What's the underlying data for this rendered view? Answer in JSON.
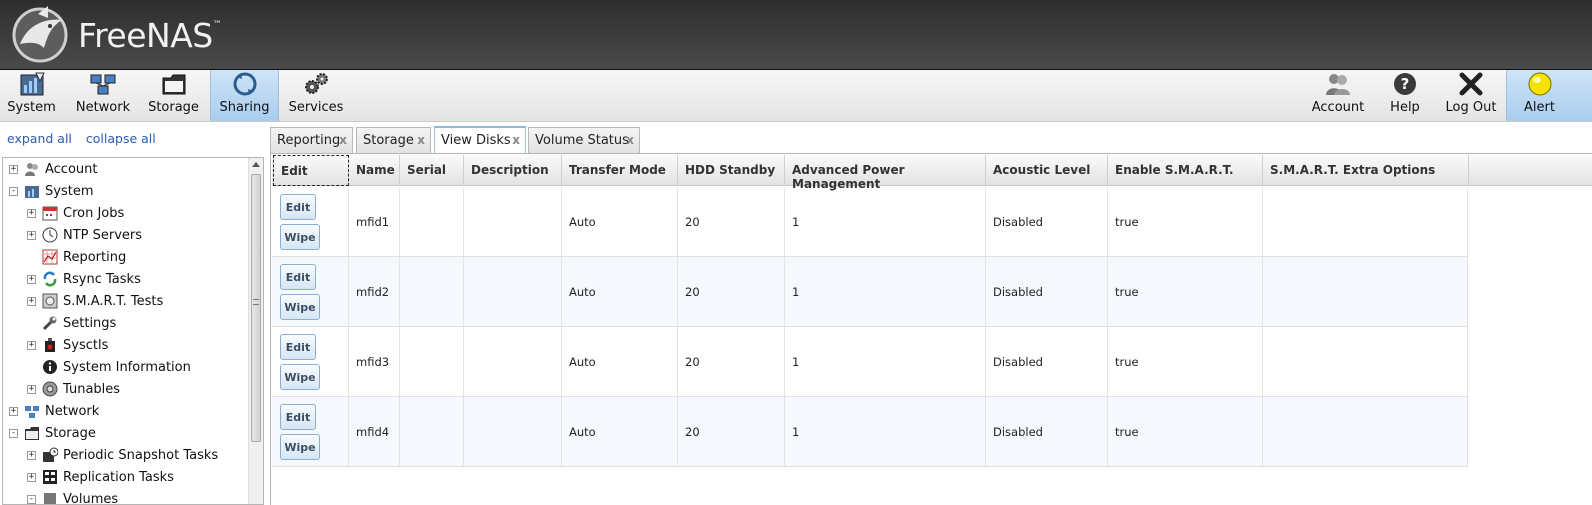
{
  "app": {
    "name": "FreeNAS",
    "trademark": "™"
  },
  "toolbar": {
    "left": [
      {
        "label": "System",
        "icon": "system-icon"
      },
      {
        "label": "Network",
        "icon": "network-icon"
      },
      {
        "label": "Storage",
        "icon": "storage-icon"
      },
      {
        "label": "Sharing",
        "icon": "sharing-icon",
        "active": true
      },
      {
        "label": "Services",
        "icon": "services-icon"
      }
    ],
    "right": [
      {
        "label": "Account",
        "icon": "account-icon"
      },
      {
        "label": "Help",
        "icon": "help-icon"
      },
      {
        "label": "Log Out",
        "icon": "logout-icon"
      },
      {
        "label": "Alert",
        "icon": "alert-icon"
      }
    ]
  },
  "sidebar": {
    "expand_all": "expand all",
    "collapse_all": "collapse all",
    "tree": [
      {
        "label": "Account",
        "level": 0,
        "expander": "+",
        "icon": "account-icon"
      },
      {
        "label": "System",
        "level": 0,
        "expander": "-",
        "icon": "system-icon"
      },
      {
        "label": "Cron Jobs",
        "level": 1,
        "expander": "+",
        "icon": "calendar-icon"
      },
      {
        "label": "NTP Servers",
        "level": 1,
        "expander": "+",
        "icon": "clock-icon"
      },
      {
        "label": "Reporting",
        "level": 1,
        "expander": "",
        "icon": "chart-icon"
      },
      {
        "label": "Rsync Tasks",
        "level": 1,
        "expander": "+",
        "icon": "sync-icon"
      },
      {
        "label": "S.M.A.R.T. Tests",
        "level": 1,
        "expander": "+",
        "icon": "disk-test-icon"
      },
      {
        "label": "Settings",
        "level": 1,
        "expander": "",
        "icon": "wrench-icon"
      },
      {
        "label": "Sysctls",
        "level": 1,
        "expander": "+",
        "icon": "sysctl-icon"
      },
      {
        "label": "System Information",
        "level": 1,
        "expander": "",
        "icon": "info-icon"
      },
      {
        "label": "Tunables",
        "level": 1,
        "expander": "+",
        "icon": "tunables-icon"
      },
      {
        "label": "Network",
        "level": 0,
        "expander": "+",
        "icon": "network-icon"
      },
      {
        "label": "Storage",
        "level": 0,
        "expander": "-",
        "icon": "storage-icon"
      },
      {
        "label": "Periodic Snapshot Tasks",
        "level": 1,
        "expander": "+",
        "icon": "snapshot-icon"
      },
      {
        "label": "Replication Tasks",
        "level": 1,
        "expander": "+",
        "icon": "replication-icon"
      },
      {
        "label": "Volumes",
        "level": 1,
        "expander": "-",
        "icon": "volumes-icon"
      }
    ]
  },
  "tabs": [
    {
      "label": "Reporting",
      "close": "x"
    },
    {
      "label": "Storage",
      "close": "x"
    },
    {
      "label": "View Disks",
      "close": "x",
      "active": true
    },
    {
      "label": "Volume Status",
      "close": "x"
    }
  ],
  "grid": {
    "headers": [
      "Edit",
      "Name",
      "Serial",
      "Description",
      "Transfer Mode",
      "HDD Standby",
      "Advanced Power Management",
      "Acoustic Level",
      "Enable S.M.A.R.T.",
      "S.M.A.R.T. Extra Options"
    ],
    "edit_label": "Edit",
    "wipe_label": "Wipe",
    "rows": [
      {
        "name": "mfid1",
        "serial": "",
        "description": "",
        "transfer_mode": "Auto",
        "hdd_standby": "20",
        "apm": "1",
        "acoustic": "Disabled",
        "smart": "true",
        "smart_extra": ""
      },
      {
        "name": "mfid2",
        "serial": "",
        "description": "",
        "transfer_mode": "Auto",
        "hdd_standby": "20",
        "apm": "1",
        "acoustic": "Disabled",
        "smart": "true",
        "smart_extra": ""
      },
      {
        "name": "mfid3",
        "serial": "",
        "description": "",
        "transfer_mode": "Auto",
        "hdd_standby": "20",
        "apm": "1",
        "acoustic": "Disabled",
        "smart": "true",
        "smart_extra": ""
      },
      {
        "name": "mfid4",
        "serial": "",
        "description": "",
        "transfer_mode": "Auto",
        "hdd_standby": "20",
        "apm": "1",
        "acoustic": "Disabled",
        "smart": "true",
        "smart_extra": ""
      }
    ]
  },
  "colors": {
    "header_dark": "#3a3a3a",
    "active_tab": "#a9cdee",
    "link": "#2a5db0",
    "alert_yellow": "#f6e200"
  }
}
